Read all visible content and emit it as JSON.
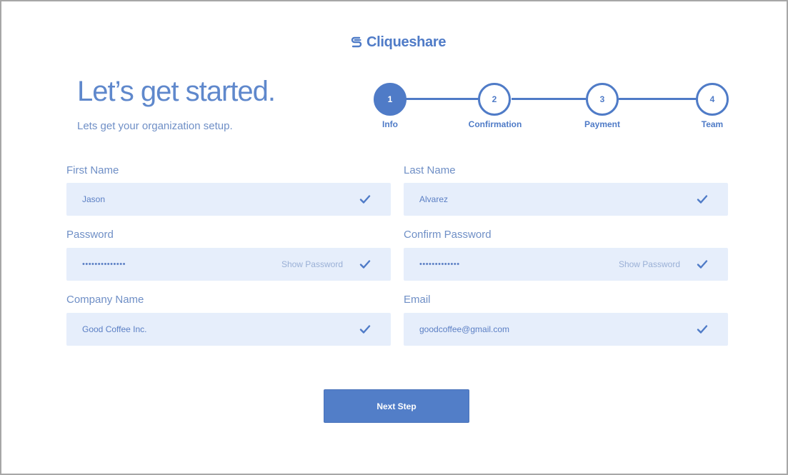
{
  "brand": {
    "name": "Cliqueshare",
    "logo_icon": "cliqueshare-logo-icon",
    "accent": "#4f7bc7"
  },
  "hero": {
    "title": "Let’s get started.",
    "subtitle": "Lets get your organization setup."
  },
  "steps": [
    {
      "number": "1",
      "label": "Info",
      "active": true
    },
    {
      "number": "2",
      "label": "Confirmation",
      "active": false
    },
    {
      "number": "3",
      "label": "Payment",
      "active": false
    },
    {
      "number": "4",
      "label": "Team",
      "active": false
    }
  ],
  "form": {
    "first_name": {
      "label": "First Name",
      "value": "Jason"
    },
    "last_name": {
      "label": "Last Name",
      "value": "Alvarez"
    },
    "password": {
      "label": "Password",
      "value": "••••••••••••••",
      "show_label": "Show Password"
    },
    "confirm_password": {
      "label": "Confirm Password",
      "value": "•••••••••••••",
      "show_label": "Show Password"
    },
    "company_name": {
      "label": "Company Name",
      "value": "Good Coffee Inc."
    },
    "email": {
      "label": "Email",
      "value": "goodcoffee@gmail.com"
    }
  },
  "actions": {
    "next_label": "Next Step"
  },
  "icons": {
    "valid": "checkmark-icon"
  }
}
